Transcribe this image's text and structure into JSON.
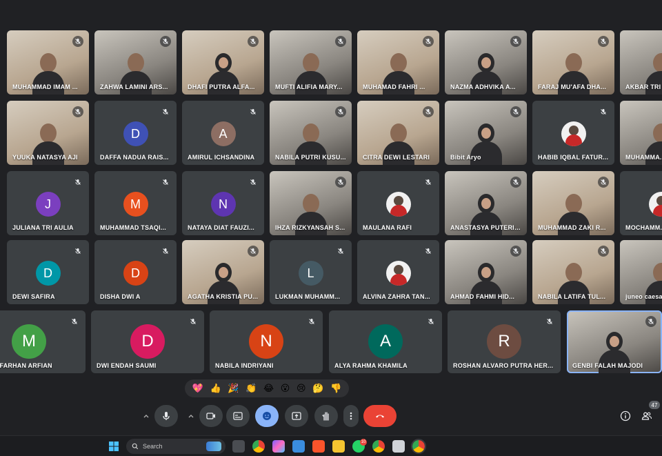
{
  "participants": {
    "row1": [
      {
        "name": "MUHAMMAD IMAM ...",
        "type": "video"
      },
      {
        "name": "ZAHWA LAMINI ARS...",
        "type": "video"
      },
      {
        "name": "DHAFI PUTRA ALFA...",
        "type": "video"
      },
      {
        "name": "MUFTI ALIFIA MARY...",
        "type": "video"
      },
      {
        "name": "MUHAMAD FAHRI ...",
        "type": "video"
      },
      {
        "name": "NAZMA ADHVIKA A...",
        "type": "video"
      },
      {
        "name": "FARAJ MU'AFA DHA...",
        "type": "video"
      },
      {
        "name": "AKBAR TRI R...",
        "type": "video"
      }
    ],
    "row2": [
      {
        "name": "YUUKA NATASYA AJI",
        "type": "video"
      },
      {
        "name": "DAFFA NADUA RAIS...",
        "type": "avatar",
        "initial": "D",
        "color": "#3f51b5"
      },
      {
        "name": "AMIRUL ICHSANDINA",
        "type": "avatar",
        "initial": "A",
        "color": "#8d6e63"
      },
      {
        "name": "NABILA PUTRI KUSU...",
        "type": "video"
      },
      {
        "name": "CITRA DEWI LESTARI",
        "type": "video"
      },
      {
        "name": "Bibit Aryo",
        "type": "video"
      },
      {
        "name": "HABIB IQBAL FATUR...",
        "type": "photo"
      },
      {
        "name": "MUHAMMA...",
        "type": "video"
      }
    ],
    "row3": [
      {
        "name": "JULIANA TRI AULIA",
        "type": "avatar",
        "initial": "J",
        "color": "#7b3fbf"
      },
      {
        "name": "MUHAMMAD TSAQI...",
        "type": "avatar",
        "initial": "M",
        "color": "#e8501e"
      },
      {
        "name": "NATAYA DIAT FAUZI...",
        "type": "avatar",
        "initial": "N",
        "color": "#5e35b1"
      },
      {
        "name": "IHZA RIZKYANSAH S...",
        "type": "video"
      },
      {
        "name": "MAULANA RAFI",
        "type": "photo"
      },
      {
        "name": "ANASTASYA PUTERI ...",
        "type": "video"
      },
      {
        "name": "MUHAMMAD ZAKI R...",
        "type": "video"
      },
      {
        "name": "MOCHAMM...",
        "type": "photo"
      }
    ],
    "row4": [
      {
        "name": "DEWI SAFIRA",
        "type": "avatar",
        "initial": "D",
        "color": "#0097a7"
      },
      {
        "name": "DISHA DWI A",
        "type": "avatar",
        "initial": "D",
        "color": "#d84315"
      },
      {
        "name": "AGATHA KRISTIA PU...",
        "type": "video"
      },
      {
        "name": "LUKMAN MUHAMM...",
        "type": "avatar",
        "initial": "L",
        "color": "#455a64"
      },
      {
        "name": "ALVINA ZAHRA TAN...",
        "type": "photo"
      },
      {
        "name": "AHMAD FAHMI HID...",
        "type": "video"
      },
      {
        "name": "NABILA LATIFA TUL...",
        "type": "video"
      },
      {
        "name": "juneo caesa...",
        "type": "video"
      }
    ],
    "row5": [
      {
        "name": "MMAD FARHAN ARFIAN",
        "type": "avatar",
        "initial": "M",
        "color": "#43a047"
      },
      {
        "name": "DWI ENDAH SAUMI",
        "type": "avatar",
        "initial": "D",
        "color": "#d81b60"
      },
      {
        "name": "NABILA INDRIYANI",
        "type": "avatar",
        "initial": "N",
        "color": "#d84315"
      },
      {
        "name": "ALYA RAHMA KHAMILA",
        "type": "avatar",
        "initial": "A",
        "color": "#00695c"
      },
      {
        "name": "ROSHAN ALVARO PUTRA HER...",
        "type": "avatar",
        "initial": "R",
        "color": "#6d4c41"
      },
      {
        "name": "GENBI FALAH MAJODI",
        "type": "video"
      }
    ]
  },
  "reactions": [
    "💖",
    "👍",
    "🎉",
    "👏",
    "😂",
    "😮",
    "😢",
    "🤔",
    "👎"
  ],
  "controls": {
    "participant_count": "47"
  },
  "taskbar": {
    "search_placeholder": "Search",
    "whatsapp_badge": "10"
  },
  "colors": {
    "background": "#202124",
    "tile": "#3c4043",
    "end_call": "#ea4335",
    "active": "#8ab4f8"
  }
}
